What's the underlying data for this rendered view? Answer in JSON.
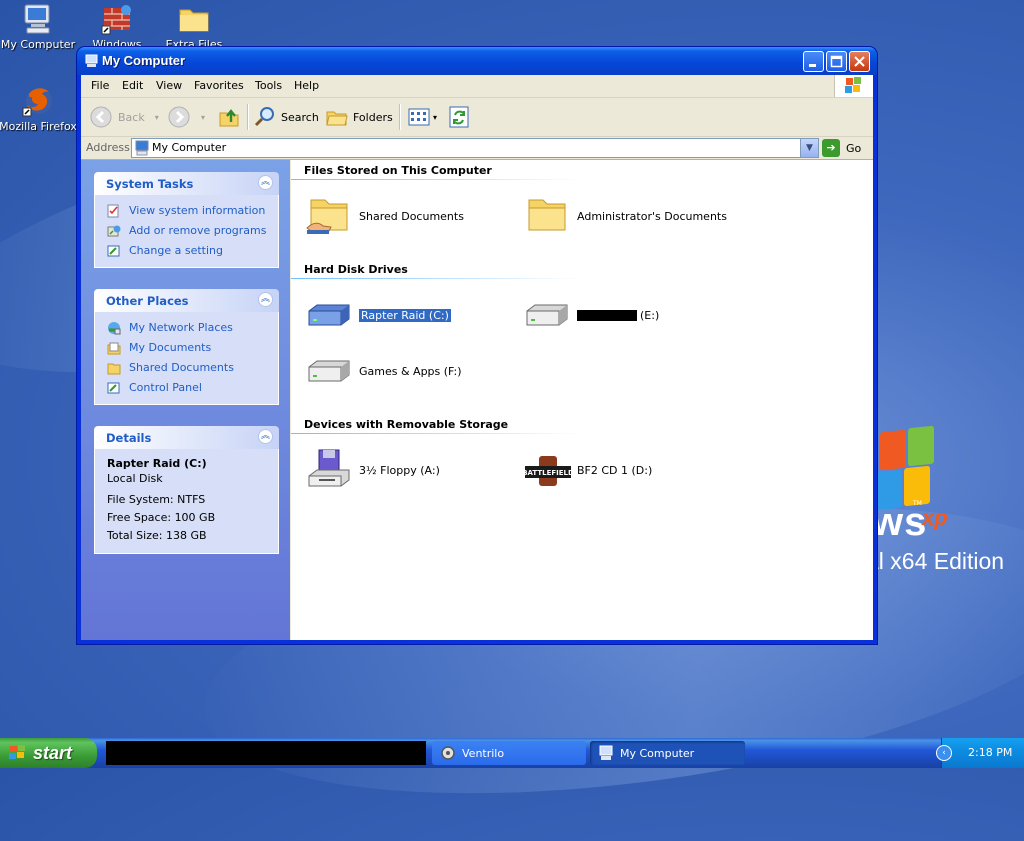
{
  "desktop": {
    "icons": [
      {
        "label": "My Computer"
      },
      {
        "label": "Windows"
      },
      {
        "label": "Extra Files"
      },
      {
        "label": "Mozilla Firefox"
      }
    ],
    "wallpaper": {
      "logo_text": "ws",
      "logo_xp": "xp",
      "logo_tm": "TM",
      "edition_text": "al x64 Edition"
    }
  },
  "window": {
    "title": "My Computer",
    "menu": [
      "File",
      "Edit",
      "View",
      "Favorites",
      "Tools",
      "Help"
    ],
    "toolbar": {
      "back_label": "Back",
      "search_label": "Search",
      "folders_label": "Folders"
    },
    "address": {
      "label": "Address",
      "value": "My Computer",
      "go_label": "Go"
    },
    "task_pane": {
      "system_tasks": {
        "title": "System Tasks",
        "links": [
          "View system information",
          "Add or remove programs",
          "Change a setting"
        ]
      },
      "other_places": {
        "title": "Other Places",
        "links": [
          "My Network Places",
          "My Documents",
          "Shared Documents",
          "Control Panel"
        ]
      },
      "details": {
        "title": "Details",
        "name": "Rapter Raid (C:)",
        "type": "Local Disk",
        "file_system": "File System: NTFS",
        "free_space": "Free Space: 100 GB",
        "total_size": "Total Size: 138 GB"
      }
    },
    "content": {
      "groups": [
        {
          "title": "Files Stored on This Computer",
          "items": [
            "Shared Documents",
            "Administrator's Documents"
          ]
        },
        {
          "title": "Hard Disk Drives",
          "items": [
            "Rapter Raid (C:)",
            "(E:)",
            "Games & Apps (F:)"
          ]
        },
        {
          "title": "Devices with Removable Storage",
          "items": [
            "3½ Floppy (A:)",
            "BF2 CD 1 (D:)"
          ]
        }
      ],
      "selected_item": "Rapter Raid (C:)"
    }
  },
  "taskbar": {
    "start_label": "start",
    "tasks": [
      {
        "label": "Ventrilo",
        "active": false
      },
      {
        "label": "My Computer",
        "active": true
      }
    ],
    "clock": "2:18 PM"
  },
  "colors": {
    "titlebar_blue": "#0546d7",
    "link_blue": "#215dc6",
    "taskpane_blue": "#7ba2e7",
    "selection_blue": "#316ac5",
    "start_green": "#3a9c37"
  }
}
